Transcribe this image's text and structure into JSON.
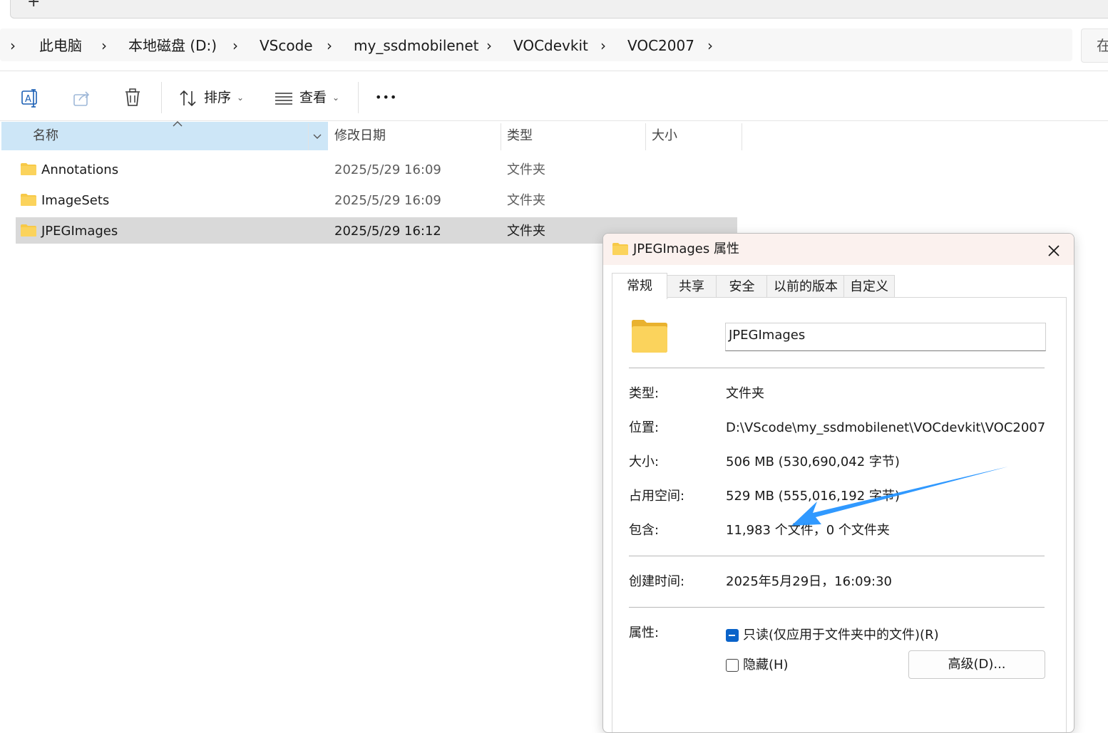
{
  "tabstrip": {
    "new_tab_symbol": "+"
  },
  "breadcrumb": {
    "items": [
      "此电脑",
      "本地磁盘 (D:)",
      "VScode",
      "my_ssdmobilenet",
      "VOCdevkit",
      "VOC2007"
    ],
    "search_partial": "在"
  },
  "toolbar": {
    "sort_label": "排序",
    "view_label": "查看",
    "more_label": "•••"
  },
  "columns": {
    "name": "名称",
    "modified": "修改日期",
    "type": "类型",
    "size": "大小"
  },
  "files": [
    {
      "name": "Annotations",
      "modified": "2025/5/29 16:09",
      "type": "文件夹"
    },
    {
      "name": "ImageSets",
      "modified": "2025/5/29 16:09",
      "type": "文件夹"
    },
    {
      "name": "JPEGImages",
      "modified": "2025/5/29 16:12",
      "type": "文件夹"
    }
  ],
  "dialog": {
    "title": "JPEGImages 属性",
    "tabs": [
      "常规",
      "共享",
      "安全",
      "以前的版本",
      "自定义"
    ],
    "name_value": "JPEGImages",
    "type_label": "类型:",
    "type_value": "文件夹",
    "location_label": "位置:",
    "location_value": "D:\\VScode\\my_ssdmobilenet\\VOCdevkit\\VOC2007",
    "size_label": "大小:",
    "size_value": "506 MB (530,690,042 字节)",
    "disk_label": "占用空间:",
    "disk_value": "529 MB (555,016,192 字节)",
    "contains_label": "包含:",
    "contains_value": "11,983 个文件，0 个文件夹",
    "created_label": "创建时间:",
    "created_value": "2025年5月29日，16:09:30",
    "attrs_label": "属性:",
    "readonly_label": "只读(仅应用于文件夹中的文件)(R)",
    "hidden_label": "隐藏(H)",
    "advanced_label": "高级(D)..."
  },
  "colors": {
    "accent": "#0a63c9",
    "selection_header": "#cde6f7",
    "selection_row": "#d9d9d9",
    "folder_yellow": "#f7c948",
    "arrow_blue": "#1e90ff"
  }
}
